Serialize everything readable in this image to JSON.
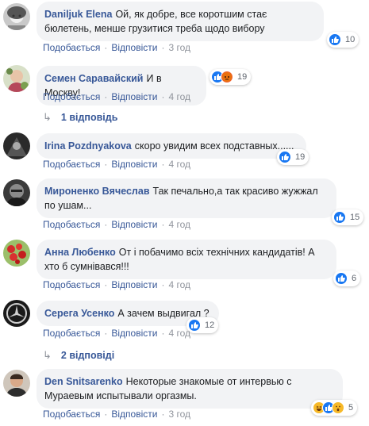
{
  "actions": {
    "like": "Подобається",
    "reply": "Відповісти"
  },
  "comments": [
    {
      "author": "Daniljuk Elena",
      "text": "Ой, як добре, все коротшим стає бюлетень, менше грузитися треба щодо вибору",
      "time": "3 год",
      "reactions": "10"
    },
    {
      "author": "Семен Саравайский",
      "text": "И в Москву!",
      "time": "4 год",
      "reactions": "19"
    },
    {
      "author": "Irina Pozdnyakova",
      "text": "скоро увидим всех подставных......",
      "time": "4 год",
      "reactions": "19"
    },
    {
      "author": "Мироненко Вячеслав",
      "text": "Так печально,а так красиво жужжал по ушам...",
      "time": "4 год",
      "reactions": "15"
    },
    {
      "author": "Анна Любенко",
      "text": "От і побачимо всіх технічних кандидатів! А хто б сумнівався!!!",
      "time": "4 год",
      "reactions": "6"
    },
    {
      "author": "Серега Усенко",
      "text": "А зачем выдвигал ?",
      "time": "4 год",
      "reactions": "12"
    },
    {
      "author": "Den Snitsarenko",
      "text": "Некоторые знакомые от интервью с Мураевым испытывали оргазмы.",
      "time": "3 год",
      "reactions": "5"
    }
  ],
  "replies": {
    "one": "1 відповідь",
    "two": "2 відповіді"
  },
  "colors": {
    "link": "#385898",
    "bubble": "#f2f3f5",
    "like": "#1877f2",
    "meta": "#90949c"
  },
  "icons": [
    "avatar",
    "like-icon",
    "angry-icon",
    "haha-icon",
    "wow-icon",
    "reply-arrow-icon"
  ]
}
